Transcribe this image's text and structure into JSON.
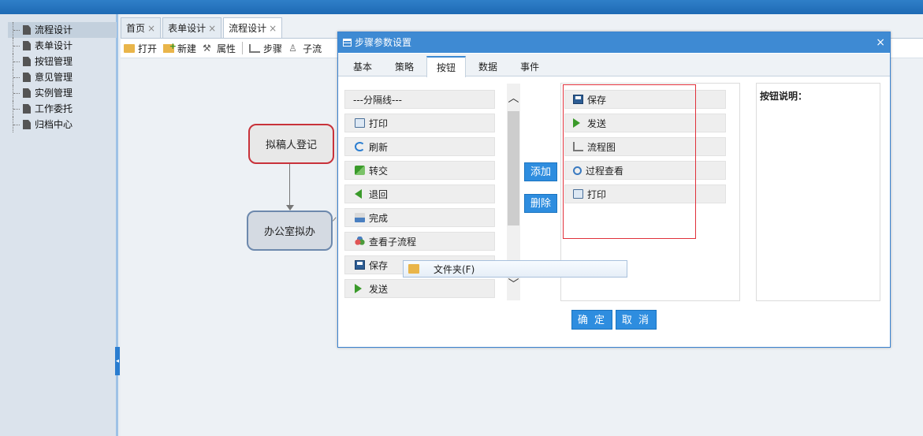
{
  "sidebar": {
    "items": [
      {
        "label": "流程设计"
      },
      {
        "label": "表单设计"
      },
      {
        "label": "按钮管理"
      },
      {
        "label": "意见管理"
      },
      {
        "label": "实例管理"
      },
      {
        "label": "工作委托"
      },
      {
        "label": "归档中心"
      }
    ]
  },
  "tabs": [
    {
      "label": "首页"
    },
    {
      "label": "表单设计"
    },
    {
      "label": "流程设计"
    }
  ],
  "tab_close": "×",
  "toolbar": {
    "open": "打开",
    "new": "新建",
    "properties": "属性",
    "step": "步骤",
    "subflow": "子流"
  },
  "canvas": {
    "node_start": "拟稿人登记",
    "node_office": "办公室拟办"
  },
  "dialog": {
    "title": "步骤参数设置",
    "close": "×",
    "tabs": [
      "基本",
      "策略",
      "按钮",
      "数据",
      "事件"
    ],
    "available_buttons": [
      {
        "label": "---分隔线---",
        "icon": "none"
      },
      {
        "label": "打印",
        "icon": "print-icon"
      },
      {
        "label": "刷新",
        "icon": "refresh-icon"
      },
      {
        "label": "转交",
        "icon": "transfer-icon"
      },
      {
        "label": "退回",
        "icon": "back-icon"
      },
      {
        "label": "完成",
        "icon": "complete-icon"
      },
      {
        "label": "查看子流程",
        "icon": "subflow-icon"
      },
      {
        "label": "保存",
        "icon": "save-icon"
      },
      {
        "label": "发送",
        "icon": "send-icon"
      }
    ],
    "add_label": "添加",
    "delete_label": "删除",
    "selected_buttons": [
      {
        "label": "保存",
        "icon": "save-icon"
      },
      {
        "label": "发送",
        "icon": "send-icon"
      },
      {
        "label": "流程图",
        "icon": "flowchart-icon"
      },
      {
        "label": "过程查看",
        "icon": "search-icon"
      },
      {
        "label": "打印",
        "icon": "print-icon"
      }
    ],
    "description_label": "按钮说明：",
    "ok_label": "确 定",
    "cancel_label": "取 消",
    "scroll_up": "︿",
    "scroll_down": "﹀"
  },
  "tooltip": {
    "label": "文件夹(F)"
  },
  "colors": {
    "accent": "#3e8ad3",
    "button": "#2e8ddf",
    "highlight_box": "#e0303a"
  }
}
